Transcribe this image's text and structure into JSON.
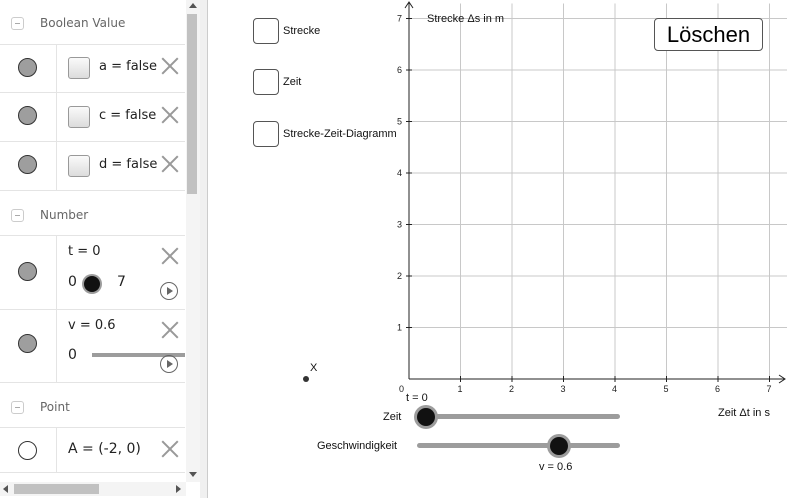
{
  "algebra": {
    "groups": {
      "boolean": "Boolean Value",
      "number": "Number",
      "point": "Point"
    },
    "booleans": [
      {
        "text": "a = false",
        "checked": false
      },
      {
        "text": "c = false",
        "checked": false
      },
      {
        "text": "d = false",
        "checked": false
      }
    ],
    "numbers": [
      {
        "text": "t = 0",
        "min": "0",
        "max": "7",
        "value": 0
      },
      {
        "text": "v = 0.6",
        "min": "0",
        "value": 0.6
      }
    ],
    "points": [
      {
        "text": "A = (-2, 0)"
      }
    ]
  },
  "graphics": {
    "checkboxes": [
      {
        "label": "Strecke",
        "checked": false
      },
      {
        "label": "Zeit",
        "checked": false
      },
      {
        "label": "Strecke-Zeit-Diagramm",
        "checked": false
      }
    ],
    "delete_button": "Löschen",
    "point_label": "X",
    "sliders": {
      "zeit_label": "Zeit",
      "zeit_value_label": "t = 0",
      "zeit_value": 0,
      "geschw_label": "Geschwindigkeit",
      "geschw_value_label": "v = 0.6",
      "geschw_value": 0.6
    }
  },
  "chart_data": {
    "type": "line",
    "xlabel": "Zeit Δt in s",
    "ylabel": "Strecke Δs in m",
    "xlim": [
      0,
      7
    ],
    "ylim": [
      0,
      7
    ],
    "x_ticks": [
      "0",
      "1",
      "2",
      "3",
      "4",
      "5",
      "6",
      "7"
    ],
    "y_ticks": [
      "1",
      "2",
      "3",
      "4",
      "5",
      "6",
      "7"
    ],
    "grid": true,
    "series": []
  },
  "colors": {
    "grid": "#c8c8c8",
    "axis": "#222222",
    "slider_track": "#9c9c9c",
    "marble_filled": "#9e9e9e"
  }
}
